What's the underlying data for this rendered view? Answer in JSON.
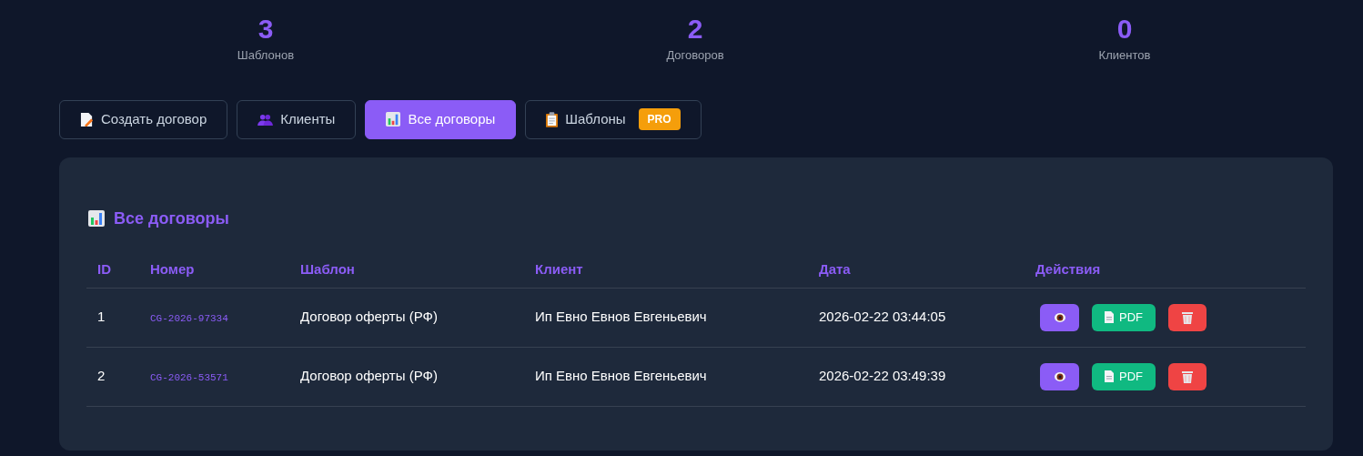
{
  "stats": [
    {
      "value": "3",
      "label": "Шаблонов"
    },
    {
      "value": "2",
      "label": "Договоров"
    },
    {
      "value": "0",
      "label": "Клиентов"
    }
  ],
  "tabs": [
    {
      "label": "Создать договор",
      "kind": "doc-pen",
      "selected": false
    },
    {
      "label": "Клиенты",
      "kind": "people",
      "selected": false
    },
    {
      "label": "Все договоры",
      "kind": "chart",
      "selected": true
    },
    {
      "label": "Шаблоны",
      "kind": "clipboard",
      "selected": false,
      "badge": "PRO"
    }
  ],
  "panel": {
    "title": "Все договоры",
    "table": {
      "columns": [
        "ID",
        "Номер",
        "Шаблон",
        "Клиент",
        "Дата",
        "Действия"
      ],
      "rows": [
        {
          "id": "1",
          "number": "CG-2026-97334",
          "template": "Договор оферты (РФ)",
          "client": "Ип Евно Евнов Евгеньевич",
          "date": "2026-02-22 03:44:05",
          "actions": [
            {
              "kind": "view"
            },
            {
              "kind": "pdf",
              "label": "PDF"
            },
            {
              "kind": "delete"
            }
          ]
        },
        {
          "id": "2",
          "number": "CG-2026-53571",
          "template": "Договор оферты (РФ)",
          "client": "Ип Евно Евнов Евгеньевич",
          "date": "2026-02-22 03:49:39",
          "actions": [
            {
              "kind": "view"
            },
            {
              "kind": "pdf",
              "label": "PDF"
            },
            {
              "kind": "delete"
            }
          ]
        }
      ]
    }
  }
}
